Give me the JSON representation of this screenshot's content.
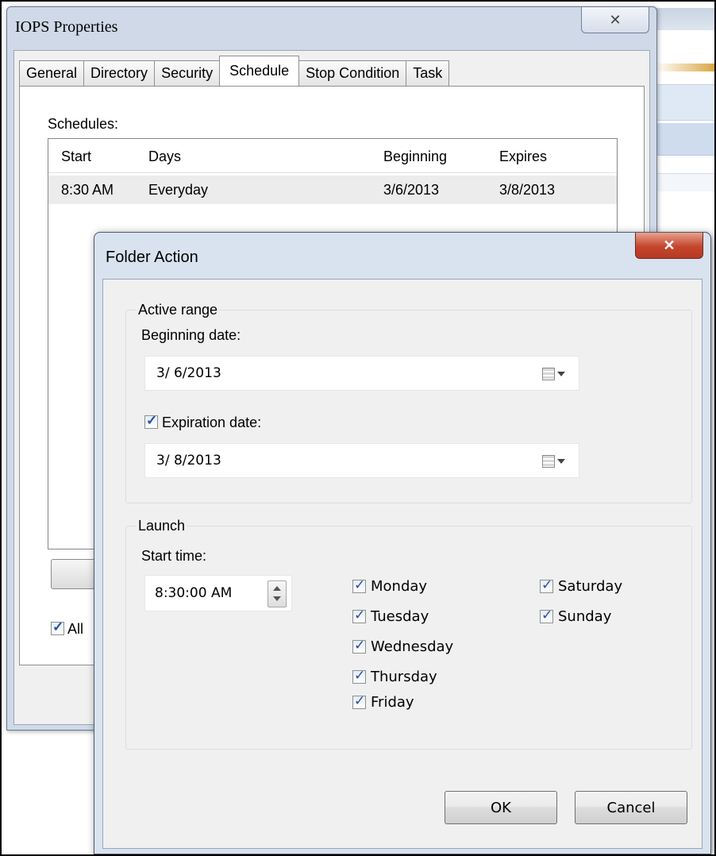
{
  "properties_window": {
    "title": "IOPS Properties",
    "close_label": "✕",
    "tabs": [
      {
        "label": "General"
      },
      {
        "label": "Directory"
      },
      {
        "label": "Security"
      },
      {
        "label": "Schedule",
        "active": true
      },
      {
        "label": "Stop Condition"
      },
      {
        "label": "Task"
      }
    ],
    "schedules_label": "Schedules:",
    "columns": [
      "Start",
      "Days",
      "Beginning",
      "Expires"
    ],
    "rows": [
      {
        "start": "8:30 AM",
        "days": "Everyday",
        "beginning": "3/6/2013",
        "expires": "3/8/2013"
      }
    ],
    "all_checkbox_label": "All",
    "all_checkbox_checked": true
  },
  "folder_action": {
    "title": "Folder Action",
    "close_label": "✕",
    "active_range": {
      "group_label": "Active range",
      "beginning_label": "Beginning date:",
      "beginning_value": "3/ 6/2013",
      "expiration_label": "Expiration date:",
      "expiration_checked": true,
      "expiration_value": "3/ 8/2013"
    },
    "launch": {
      "group_label": "Launch",
      "start_time_label": "Start time:",
      "start_time_value": "8:30:00 AM",
      "days": [
        {
          "label": "Monday",
          "checked": true
        },
        {
          "label": "Tuesday",
          "checked": true
        },
        {
          "label": "Wednesday",
          "checked": true
        },
        {
          "label": "Thursday",
          "checked": true
        },
        {
          "label": "Friday",
          "checked": true
        },
        {
          "label": "Saturday",
          "checked": true
        },
        {
          "label": "Sunday",
          "checked": true
        }
      ]
    },
    "ok_label": "OK",
    "cancel_label": "Cancel"
  },
  "colors": {
    "title_bar": "#cfd9e8",
    "dialog_title_bar": "#d9e3ef",
    "close_button_red": "#c4452c",
    "checkbox_check": "#2b4f9c"
  }
}
